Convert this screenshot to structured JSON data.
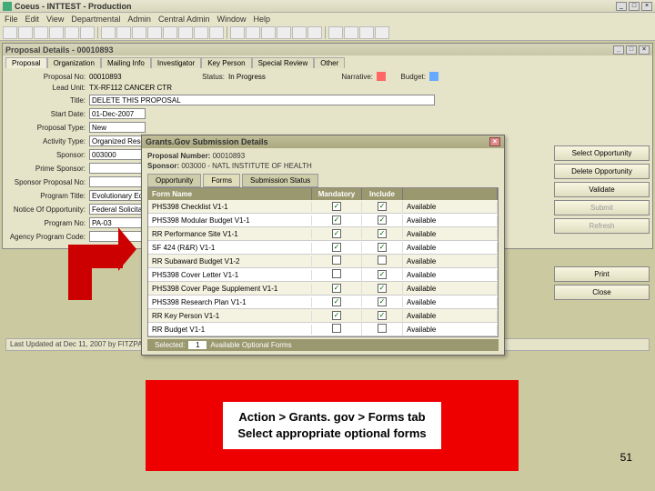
{
  "app": {
    "title": "Coeus - INTTEST - Production"
  },
  "menubar": [
    "File",
    "Edit",
    "View",
    "Departmental",
    "Admin",
    "Central Admin",
    "Window",
    "Help"
  ],
  "subwindow": {
    "title": "Proposal Details - 00010893"
  },
  "tabs": [
    "Proposal",
    "Organization",
    "Mailing Info",
    "Investigator",
    "Key Person",
    "Special Review",
    "Other"
  ],
  "proposal": {
    "number_label": "Proposal No:",
    "number": "00010893",
    "status_label": "Status:",
    "status": "In Progress",
    "narrative_label": "Narrative:",
    "budget_label": "Budget:",
    "lead_unit_label": "Lead Unit:",
    "lead_unit": "TX-RF112 CANCER CTR",
    "title_label": "Title:",
    "title": "DELETE THIS PROPOSAL",
    "start_date_label": "Start Date:",
    "start_date": "01-Dec-2007",
    "type_label": "Proposal Type:",
    "type": "New",
    "activity_label": "Activity Type:",
    "activity": "Organized Research",
    "sponsor_label": "Sponsor:",
    "sponsor": "003000",
    "prime_label": "Prime Sponsor:",
    "sp_prop_label": "Sponsor Proposal No:",
    "program_title_label": "Program Title:",
    "program_title": "Evolutionary Ecology and Con",
    "notice_label": "Notice Of Opportunity:",
    "notice": "Federal Solicitation",
    "program_no_label": "Program No:",
    "program_no": "PA-03",
    "agency_label": "Agency Program Code:"
  },
  "dialog": {
    "title": "Grants.Gov Submission Details",
    "prop_no_label": "Proposal Number:",
    "prop_no": "00010893",
    "sponsor_label": "Sponsor:",
    "sponsor": "003000 - NATL INSTITUTE OF HEALTH",
    "tabs": [
      "Opportunity",
      "Forms",
      "Submission Status"
    ],
    "headers": {
      "name": "Form Name",
      "mandatory": "Mandatory",
      "include": "Include",
      "status": ""
    },
    "rows": [
      {
        "name": "PHS398 Checklist V1-1",
        "mandatory": true,
        "include": true,
        "status": "Available"
      },
      {
        "name": "PHS398 Modular Budget V1-1",
        "mandatory": true,
        "include": true,
        "status": "Available"
      },
      {
        "name": "RR Performance Site V1-1",
        "mandatory": true,
        "include": true,
        "status": "Available"
      },
      {
        "name": "SF 424 (R&R) V1-1",
        "mandatory": true,
        "include": true,
        "status": "Available"
      },
      {
        "name": "RR Subaward Budget V1-2",
        "mandatory": false,
        "include": false,
        "status": "Available"
      },
      {
        "name": "PHS398 Cover Letter V1-1",
        "mandatory": false,
        "include": true,
        "status": "Available"
      },
      {
        "name": "PHS398 Cover Page Supplement V1-1",
        "mandatory": true,
        "include": true,
        "status": "Available"
      },
      {
        "name": "PHS398 Research Plan V1-1",
        "mandatory": true,
        "include": true,
        "status": "Available"
      },
      {
        "name": "RR Key Person V1-1",
        "mandatory": true,
        "include": true,
        "status": "Available"
      },
      {
        "name": "RR Budget V1-1",
        "mandatory": false,
        "include": false,
        "status": "Available"
      }
    ],
    "selected_label": "Selected:",
    "selected_count": "1",
    "selected_hint": "Available Optional Forms"
  },
  "buttons": {
    "select_opp": "Select Opportunity",
    "delete_opp": "Delete Opportunity",
    "validate": "Validate",
    "submit": "Submit",
    "refresh": "Refresh",
    "print": "Print",
    "close": "Close"
  },
  "bottom_status": "Last Updated at Dec 11, 2007 by FITZPATRICK",
  "caption": {
    "line1": "Action > Grants. gov > Forms tab",
    "line2": "Select appropriate optional forms"
  },
  "page_number": "51"
}
